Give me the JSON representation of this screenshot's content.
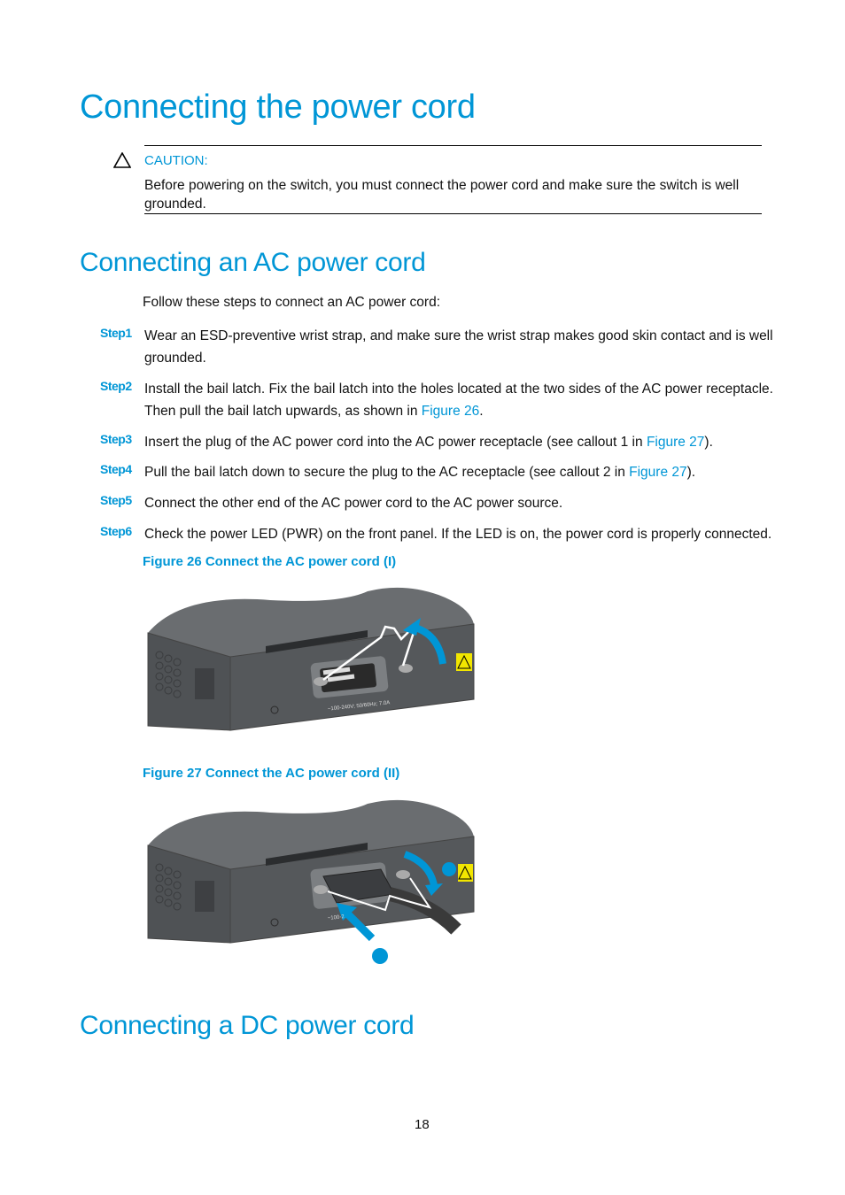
{
  "title": "Connecting the power cord",
  "caution": {
    "label": "CAUTION:",
    "text": "Before powering on the switch, you must connect the power cord and make sure the switch is well grounded."
  },
  "ac_section": {
    "heading": "Connecting an AC power cord",
    "intro": "Follow these steps to connect an AC power cord:",
    "steps": [
      {
        "label": "Step1",
        "text": "Wear an ESD-preventive wrist strap, and make sure the wrist strap makes good skin contact and is well grounded."
      },
      {
        "label": "Step2",
        "text_before": "Install the bail latch. Fix the bail latch into the holes located at the two sides of the AC power receptacle. Then pull the bail latch upwards, as shown in ",
        "link": "Figure 26",
        "text_after": "."
      },
      {
        "label": "Step3",
        "text_before": "Insert the plug of the AC power cord into the AC power receptacle (see callout 1 in ",
        "link": "Figure 27",
        "text_after": ")."
      },
      {
        "label": "Step4",
        "text_before": "Pull the bail latch down to secure the plug to the AC receptacle (see callout 2 in ",
        "link": "Figure 27",
        "text_after": ")."
      },
      {
        "label": "Step5",
        "text": "Connect the other end of the AC power cord to the AC power source."
      },
      {
        "label": "Step6",
        "text": "Check the power LED (PWR) on the front panel. If the LED is on, the power cord is properly connected."
      }
    ],
    "figures": [
      {
        "caption": "Figure 26 Connect the AC power cord (I)",
        "rating_label": "~100-240V; 50/60Hz; 7.0A"
      },
      {
        "caption": "Figure 27 Connect the AC power cord (II)",
        "rating_label": "~100-2"
      }
    ]
  },
  "dc_section": {
    "heading": "Connecting a DC power cord"
  },
  "page_number": "18",
  "colors": {
    "accent": "#0096d6",
    "device": "#5a5d60",
    "warning_label": "#f2e600"
  }
}
